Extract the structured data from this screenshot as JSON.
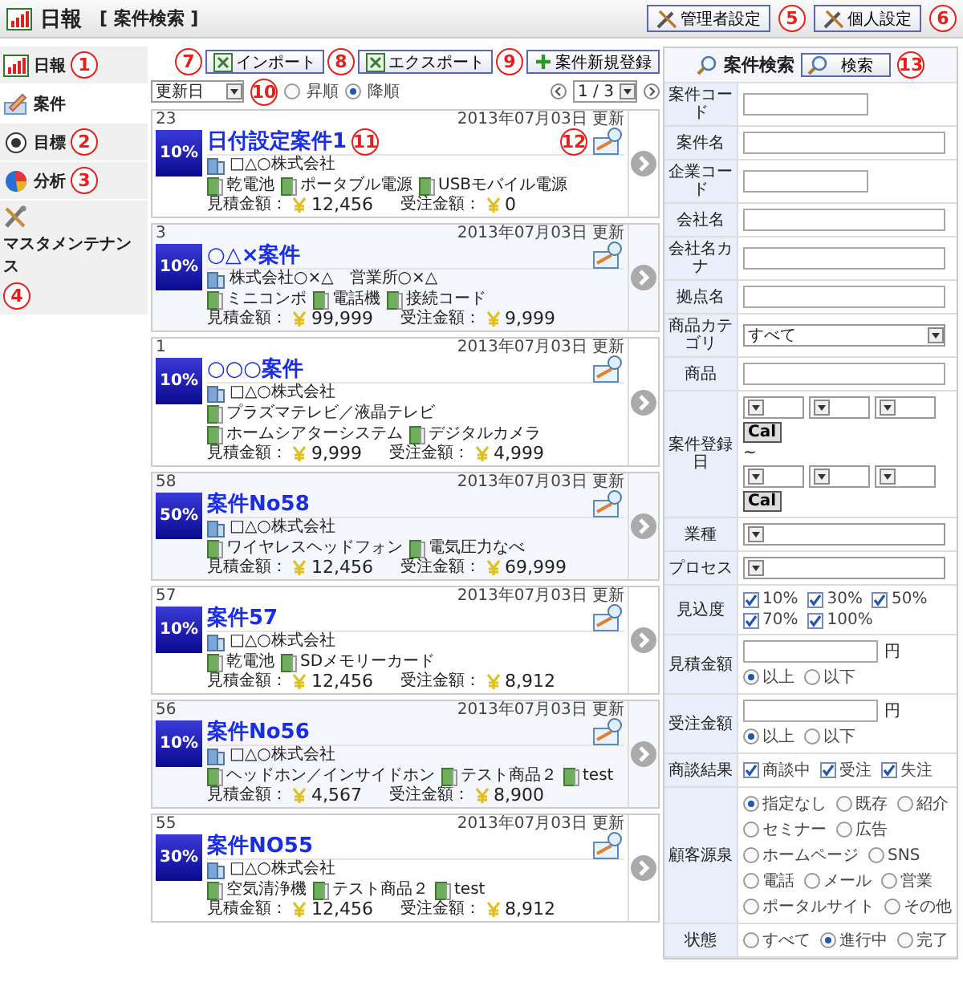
{
  "header": {
    "title": "日報",
    "subtitle": "[ 案件検索 ]",
    "buttons": [
      {
        "label": "管理者設定",
        "callout": "5"
      },
      {
        "label": "個人設定",
        "callout": "6"
      }
    ]
  },
  "sidebar": {
    "items": [
      {
        "label": "日報",
        "kind": "report",
        "selected": false,
        "callout": "1"
      },
      {
        "label": "案件",
        "kind": "deal",
        "selected": true
      },
      {
        "label": "目標",
        "kind": "goal",
        "selected": false,
        "callout": "2"
      },
      {
        "label": "分析",
        "kind": "analysis",
        "selected": false,
        "callout": "3"
      },
      {
        "label": "マスタメンテナンス",
        "kind": "maintenance",
        "selected": false,
        "callout": "4"
      }
    ]
  },
  "toolbar": {
    "callout": "10",
    "buttons": [
      {
        "label": "インポート",
        "kind": "excel",
        "callout": "7"
      },
      {
        "label": "エクスポート",
        "kind": "excel",
        "callout": "8"
      },
      {
        "label": "案件新規登録",
        "kind": "add",
        "callout": "9"
      }
    ]
  },
  "sort": {
    "field": "更新日",
    "orders": [
      {
        "label": "昇順",
        "selected": false
      },
      {
        "label": "降順",
        "selected": true
      }
    ]
  },
  "pager": {
    "value": "1 / 3"
  },
  "deals": [
    {
      "number": "23",
      "updated": "2013年07月03日 更新",
      "probability": "10%",
      "title": "日付設定案件1",
      "title_callout": "11",
      "icon_callout": "12",
      "company": "□△○株式会社",
      "products": [
        "乾電池",
        "ポータブル電源",
        "USBモバイル電源"
      ],
      "estimate_label": "見積金額：",
      "estimate": "12,456",
      "order_label": "受注金額：",
      "order": "0"
    },
    {
      "number": "3",
      "updated": "2013年07月03日 更新",
      "probability": "10%",
      "title": "○△×案件",
      "company": "株式会社○×△　営業所○×△",
      "products": [
        "ミニコンポ",
        "電話機",
        "接続コード"
      ],
      "estimate_label": "見積金額：",
      "estimate": "99,999",
      "order_label": "受注金額：",
      "order": "9,999"
    },
    {
      "number": "1",
      "updated": "2013年07月03日 更新",
      "probability": "10%",
      "title": "○○○案件",
      "company": "□△○株式会社",
      "products": [
        "プラズマテレビ／液晶テレビ",
        "ホームシアターシステム",
        "デジタルカメラ"
      ],
      "estimate_label": "見積金額：",
      "estimate": "9,999",
      "order_label": "受注金額：",
      "order": "4,999"
    },
    {
      "number": "58",
      "updated": "2013年07月03日 更新",
      "probability": "50%",
      "title": "案件No58",
      "company": "□△○株式会社",
      "products": [
        "ワイヤレスヘッドフォン",
        "電気圧力なべ"
      ],
      "estimate_label": "見積金額：",
      "estimate": "12,456",
      "order_label": "受注金額：",
      "order": "69,999"
    },
    {
      "number": "57",
      "updated": "2013年07月03日 更新",
      "probability": "10%",
      "title": "案件57",
      "company": "□△○株式会社",
      "products": [
        "乾電池",
        "SDメモリーカード"
      ],
      "estimate_label": "見積金額：",
      "estimate": "12,456",
      "order_label": "受注金額：",
      "order": "8,912"
    },
    {
      "number": "56",
      "updated": "2013年07月03日 更新",
      "probability": "10%",
      "title": "案件No56",
      "company": "□△○株式会社",
      "products": [
        "ヘッドホン／インサイドホン",
        "テスト商品２",
        "test"
      ],
      "estimate_label": "見積金額：",
      "estimate": "4,567",
      "order_label": "受注金額：",
      "order": "8,900"
    },
    {
      "number": "55",
      "updated": "2013年07月03日 更新",
      "probability": "30%",
      "title": "案件NO55",
      "company": "□△○株式会社",
      "products": [
        "空気清浄機",
        "テスト商品２",
        "test"
      ],
      "estimate_label": "見積金額：",
      "estimate": "12,456",
      "order_label": "受注金額：",
      "order": "8,912"
    }
  ],
  "search": {
    "title": "案件検索",
    "button": {
      "label": "検索",
      "callout": "13"
    },
    "rows": [
      {
        "label": "案件コード",
        "kind": "text",
        "short": true
      },
      {
        "label": "案件名",
        "kind": "text",
        "short": false
      },
      {
        "label": "企業コード",
        "kind": "text",
        "short": true
      },
      {
        "label": "会社名",
        "kind": "text",
        "short": false
      },
      {
        "label": "会社名カナ",
        "kind": "text",
        "short": false
      },
      {
        "label": "拠点名",
        "kind": "text",
        "short": false
      },
      {
        "label": "商品カテゴリ",
        "kind": "select",
        "value": "すべて"
      },
      {
        "label": "商品",
        "kind": "text",
        "short": false
      },
      {
        "label": "案件登録日",
        "kind": "daterange",
        "separator": "~",
        "buttons": [
          "Cal",
          "Cal"
        ]
      },
      {
        "label": "業種",
        "kind": "select"
      },
      {
        "label": "プロセス",
        "kind": "select"
      },
      {
        "label": "見込度",
        "kind": "checks",
        "options": [
          {
            "label": "10%",
            "checked": true
          },
          {
            "label": "30%",
            "checked": true
          },
          {
            "label": "50%",
            "checked": true
          },
          {
            "label": "70%",
            "checked": true
          },
          {
            "label": "100%",
            "checked": true
          }
        ]
      },
      {
        "label": "見積金額",
        "kind": "amount",
        "unit": "円",
        "options": [
          {
            "label": "以上",
            "selected": true
          },
          {
            "label": "以下",
            "selected": false
          }
        ]
      },
      {
        "label": "受注金額",
        "kind": "amount",
        "unit": "円",
        "options": [
          {
            "label": "以上",
            "selected": true
          },
          {
            "label": "以下",
            "selected": false
          }
        ]
      },
      {
        "label": "商談結果",
        "kind": "checks",
        "options": [
          {
            "label": "商談中",
            "checked": true
          },
          {
            "label": "受注",
            "checked": true
          },
          {
            "label": "失注",
            "checked": true
          }
        ]
      },
      {
        "label": "顧客源泉",
        "kind": "radios",
        "options": [
          {
            "label": "指定なし",
            "selected": true
          },
          {
            "label": "既存",
            "selected": false
          },
          {
            "label": "紹介",
            "selected": false
          },
          {
            "label": "セミナー",
            "selected": false
          },
          {
            "label": "広告",
            "selected": false
          },
          {
            "label": "ホームページ",
            "selected": false
          },
          {
            "label": "SNS",
            "selected": false
          },
          {
            "label": "電話",
            "selected": false
          },
          {
            "label": "メール",
            "selected": false
          },
          {
            "label": "営業",
            "selected": false
          },
          {
            "label": "ポータルサイト",
            "selected": false
          },
          {
            "label": "その他",
            "selected": false
          }
        ]
      },
      {
        "label": "状態",
        "kind": "radios",
        "options": [
          {
            "label": "すべて",
            "selected": false
          },
          {
            "label": "進行中",
            "selected": true
          },
          {
            "label": "完了",
            "selected": false
          }
        ]
      }
    ]
  }
}
